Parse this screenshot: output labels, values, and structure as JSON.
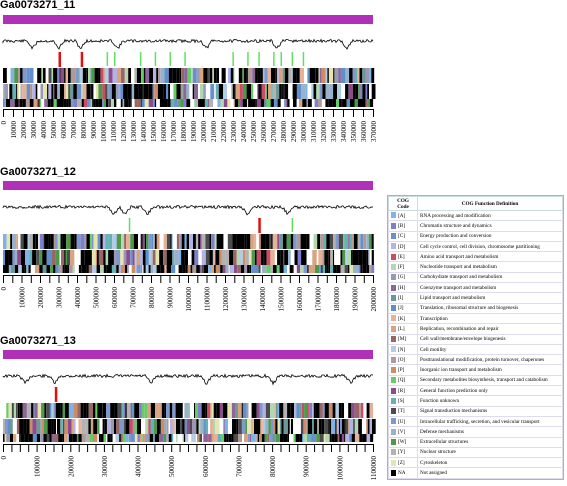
{
  "tracks": [
    {
      "title": "Ga0073271_11",
      "max": 370000,
      "step": 10000,
      "label_step": 10000,
      "seed": 11,
      "dips": [
        0.08,
        0.15,
        0.21,
        0.31,
        0.55,
        0.74,
        0.93
      ],
      "red": [
        0.15,
        0.21
      ],
      "green": [
        0.28,
        0.3,
        0.37,
        0.41,
        0.45,
        0.49,
        0.62,
        0.66,
        0.69,
        0.73,
        0.75,
        0.78,
        0.81
      ]
    },
    {
      "title": "Ga0073271_12",
      "max": 2000000,
      "step": 50000,
      "label_step": 100000,
      "seed": 12,
      "dips": [
        0.3,
        0.33,
        0.39,
        0.66,
        0.77
      ],
      "red": [
        0.69
      ],
      "green": [
        0.34,
        0.78
      ]
    },
    {
      "title": "Ga0073271_13",
      "max": 1100000,
      "step": 25000,
      "label_step": 100000,
      "seed": 13,
      "dips": [
        0.06,
        0.14,
        0.4,
        0.55,
        0.73,
        0.94
      ],
      "red": [
        0.14
      ],
      "green": []
    }
  ],
  "legend": {
    "header_code": "COG Code",
    "header_def": "COG Function Definition",
    "rows": [
      {
        "code": "[A]",
        "def": "RNA processing and modification",
        "color": "#7fb2e5"
      },
      {
        "code": "[B]",
        "def": "Chromatin structure and dynamics",
        "color": "#7f7fcc"
      },
      {
        "code": "[C]",
        "def": "Energy production and conversion",
        "color": "#6b8fcc"
      },
      {
        "code": "[D]",
        "def": "Cell cycle control, cell division, chromosome partitioning",
        "color": "#b3b3e5"
      },
      {
        "code": "[E]",
        "def": "Amino acid transport and metabolism",
        "color": "#cc4c66"
      },
      {
        "code": "[F]",
        "def": "Nucleotide transport and metabolism",
        "color": "#b2d8b2"
      },
      {
        "code": "[G]",
        "def": "Carbohydrate transport and metabolism",
        "color": "#9999b3"
      },
      {
        "code": "[H]",
        "def": "Coenzyme transport and metabolism",
        "color": "#8c6699"
      },
      {
        "code": "[I]",
        "def": "Lipid transport and metabolism",
        "color": "#6b9999"
      },
      {
        "code": "[J]",
        "def": "Translation, ribosomal structure and biogenesis",
        "color": "#5f8fcc"
      },
      {
        "code": "[K]",
        "def": "Transcription",
        "color": "#e5b299"
      },
      {
        "code": "[L]",
        "def": "Replication, recombination and repair",
        "color": "#d9a37f"
      },
      {
        "code": "[M]",
        "def": "Cell wall/membrane/envelope biogenesis",
        "color": "#996666"
      },
      {
        "code": "[N]",
        "def": "Cell motility",
        "color": "#b2cce5"
      },
      {
        "code": "[O]",
        "def": "Posttranslational modification, protein turnover, chaperones",
        "color": "#b29999"
      },
      {
        "code": "[P]",
        "def": "Inorganic ion transport and metabolism",
        "color": "#cc8c66"
      },
      {
        "code": "[Q]",
        "def": "Secondary metabolites biosynthesis, transport and catabolism",
        "color": "#66cc66"
      },
      {
        "code": "[R]",
        "def": "General function prediction only",
        "color": "#8c4c8c"
      },
      {
        "code": "[S]",
        "def": "Function unknown",
        "color": "#66b2b2"
      },
      {
        "code": "[T]",
        "def": "Signal transduction mechanisms",
        "color": "#4c4c4c"
      },
      {
        "code": "[U]",
        "def": "Intracellular trafficking, secretion, and vesicular transport",
        "color": "#7f99cc"
      },
      {
        "code": "[V]",
        "def": "Defense mechanisms",
        "color": "#99b2cc"
      },
      {
        "code": "[W]",
        "def": "Extracellular structures",
        "color": "#4c994c"
      },
      {
        "code": "[Y]",
        "def": "Nuclear structure",
        "color": "#b2b2b2"
      },
      {
        "code": "[Z]",
        "def": "Cytoskeleton",
        "color": "#e5e5b2"
      },
      {
        "code": "NA",
        "def": "Not assigned",
        "color": "#000000"
      }
    ]
  },
  "colors": {
    "magenta_bar": "#b030b8",
    "red_marker": "#e01010",
    "green_marker": "#60e060"
  }
}
